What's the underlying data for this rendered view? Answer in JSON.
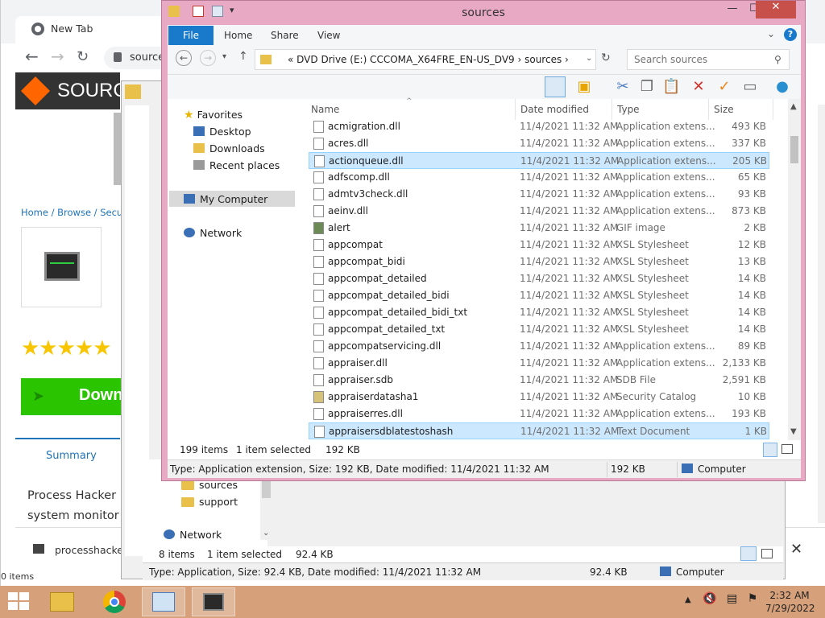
{
  "chrome": {
    "tab_title": "New Tab",
    "address": "source",
    "site_name": "SOURC",
    "breadcrumbs": "Home / Browse / Securi",
    "stars": "★★★★★",
    "download_label": "Down",
    "summary_tab": "Summary",
    "description": [
      "Process Hacker i",
      "system monitorin"
    ],
    "bottom_bar_label": "processhacker",
    "status_text": "0 items"
  },
  "explorer_back": {
    "nav_items": [
      "sources",
      "support"
    ],
    "network_label": "Network",
    "item_count": "8 items",
    "selected": "1 item selected",
    "selected_size": "92.4 KB",
    "status_type": "Type: Application, Size: 92.4 KB, Date modified: 11/4/2021 11:32 AM",
    "status_size": "92.4 KB",
    "status_location": "Computer"
  },
  "explorer": {
    "title": "sources",
    "ribbon_tabs": [
      "File",
      "Home",
      "Share",
      "View"
    ],
    "address_path": "«  DVD Drive (E:) CCCOMA_X64FRE_EN-US_DV9  ›  sources  ›",
    "search_placeholder": "Search sources",
    "nav": {
      "favorites": "Favorites",
      "desktop": "Desktop",
      "downloads": "Downloads",
      "recent": "Recent places",
      "my_computer": "My Computer",
      "network": "Network"
    },
    "columns": [
      "Name",
      "Date modified",
      "Type",
      "Size"
    ],
    "files": [
      {
        "name": "acmigration.dll",
        "date": "11/4/2021 11:32 AM",
        "type": "Application extens...",
        "size": "493 KB",
        "icon": "dll"
      },
      {
        "name": "acres.dll",
        "date": "11/4/2021 11:32 AM",
        "type": "Application extens...",
        "size": "337 KB",
        "icon": "dll"
      },
      {
        "name": "actionqueue.dll",
        "date": "11/4/2021 11:32 AM",
        "type": "Application extens...",
        "size": "205 KB",
        "icon": "dll",
        "selected": true
      },
      {
        "name": "adfscomp.dll",
        "date": "11/4/2021 11:32 AM",
        "type": "Application extens...",
        "size": "65 KB",
        "icon": "dll"
      },
      {
        "name": "admtv3check.dll",
        "date": "11/4/2021 11:32 AM",
        "type": "Application extens...",
        "size": "93 KB",
        "icon": "dll"
      },
      {
        "name": "aeinv.dll",
        "date": "11/4/2021 11:32 AM",
        "type": "Application extens...",
        "size": "873 KB",
        "icon": "dll"
      },
      {
        "name": "alert",
        "date": "11/4/2021 11:32 AM",
        "type": "GIF image",
        "size": "2 KB",
        "icon": "gif"
      },
      {
        "name": "appcompat",
        "date": "11/4/2021 11:32 AM",
        "type": "XSL Stylesheet",
        "size": "12 KB",
        "icon": "xsl"
      },
      {
        "name": "appcompat_bidi",
        "date": "11/4/2021 11:32 AM",
        "type": "XSL Stylesheet",
        "size": "13 KB",
        "icon": "xsl"
      },
      {
        "name": "appcompat_detailed",
        "date": "11/4/2021 11:32 AM",
        "type": "XSL Stylesheet",
        "size": "14 KB",
        "icon": "xsl"
      },
      {
        "name": "appcompat_detailed_bidi",
        "date": "11/4/2021 11:32 AM",
        "type": "XSL Stylesheet",
        "size": "14 KB",
        "icon": "xsl"
      },
      {
        "name": "appcompat_detailed_bidi_txt",
        "date": "11/4/2021 11:32 AM",
        "type": "XSL Stylesheet",
        "size": "14 KB",
        "icon": "xsl"
      },
      {
        "name": "appcompat_detailed_txt",
        "date": "11/4/2021 11:32 AM",
        "type": "XSL Stylesheet",
        "size": "14 KB",
        "icon": "xsl"
      },
      {
        "name": "appcompatservicing.dll",
        "date": "11/4/2021 11:32 AM",
        "type": "Application extens...",
        "size": "89 KB",
        "icon": "dll"
      },
      {
        "name": "appraiser.dll",
        "date": "11/4/2021 11:32 AM",
        "type": "Application extens...",
        "size": "2,133 KB",
        "icon": "dll"
      },
      {
        "name": "appraiser.sdb",
        "date": "11/4/2021 11:32 AM",
        "type": "SDB File",
        "size": "2,591 KB",
        "icon": "sdb"
      },
      {
        "name": "appraiserdatasha1",
        "date": "11/4/2021 11:32 AM",
        "type": "Security Catalog",
        "size": "10 KB",
        "icon": "cat"
      },
      {
        "name": "appraiserres.dll",
        "date": "11/4/2021 11:32 AM",
        "type": "Application extens...",
        "size": "193 KB",
        "icon": "dll"
      },
      {
        "name": "appraisersdblatestoshash",
        "date": "11/4/2021 11:32 AM",
        "type": "Text Document",
        "size": "1 KB",
        "icon": "txt",
        "selected": true
      }
    ],
    "item_count": "199 items",
    "selected_info": "1 item selected",
    "selected_size": "192 KB",
    "status_type": "Type: Application extension, Size: 192 KB, Date modified: 11/4/2021 11:32 AM",
    "status_size": "192 KB",
    "status_location": "Computer"
  },
  "taskbar": {
    "time": "2:32 AM",
    "date": "7/29/2022"
  },
  "colors": {
    "window_frame": "#e8a9c5",
    "accent": "#1979ca",
    "selection": "#cce8ff",
    "taskbar": "#d6a07a"
  }
}
